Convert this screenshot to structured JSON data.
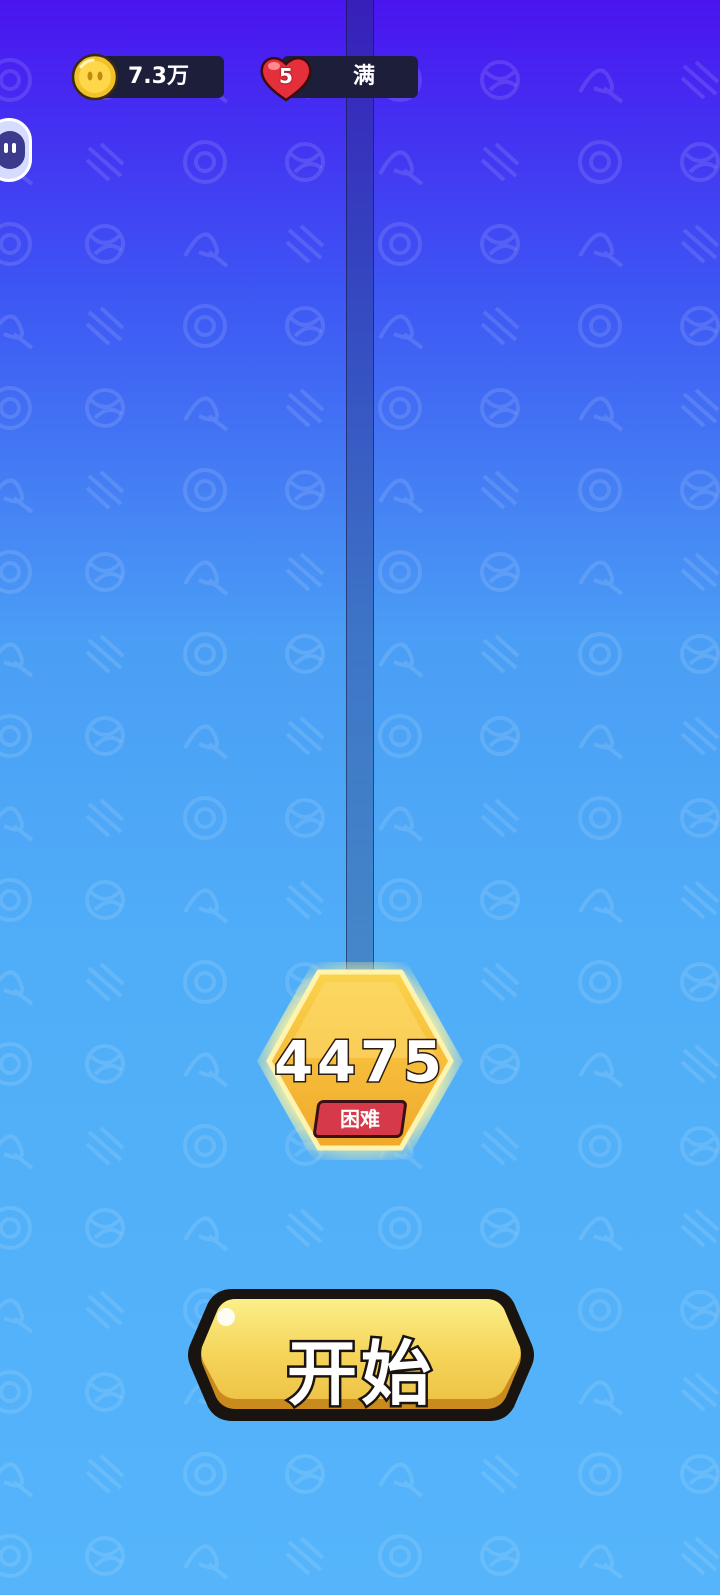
{
  "hud": {
    "coins": {
      "icon": "coin-icon",
      "amount": "7.3万"
    },
    "lives": {
      "icon": "heart-icon",
      "count": "5",
      "status": "满"
    }
  },
  "side_widget": {
    "icon": "robot-face-icon"
  },
  "level": {
    "number": "4475",
    "difficulty": "困难"
  },
  "start_button": {
    "label": "开始"
  },
  "colors": {
    "background_top": "#4a14f0",
    "background_bottom": "#55b4fa",
    "node_gold": "#f7c23a",
    "badge_red": "#d63a4a",
    "button_yellow": "#f5dc5a"
  }
}
